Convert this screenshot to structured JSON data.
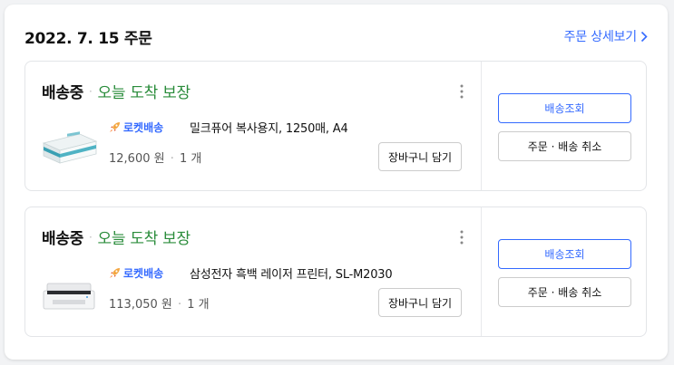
{
  "order": {
    "date": "2022. 7. 15 주문",
    "detail_link": "주문 상세보기"
  },
  "items": [
    {
      "status": "배송중",
      "arrival": "오늘 도착 보장",
      "badge": "로켓배송",
      "name": "밀크퓨어 복사용지, 1250매, A4",
      "price": "12,600 원",
      "qty": "1 개",
      "cart_button": "장바구니 담기",
      "track_button": "배송조회",
      "cancel_button": "주문 · 배송 취소",
      "thumb": "paper-box-image"
    },
    {
      "status": "배송중",
      "arrival": "오늘 도착 보장",
      "badge": "로켓배송",
      "name": "삼성전자 흑백 레이저 프린터, SL-M2030",
      "price": "113,050 원",
      "qty": "1 개",
      "cart_button": "장바구니 담기",
      "track_button": "배송조회",
      "cancel_button": "주문 · 배송 취소",
      "thumb": "printer-image"
    }
  ],
  "colors": {
    "accent": "#346aff",
    "arrival": "#2a8c3b",
    "border": "#e3e5e8"
  }
}
